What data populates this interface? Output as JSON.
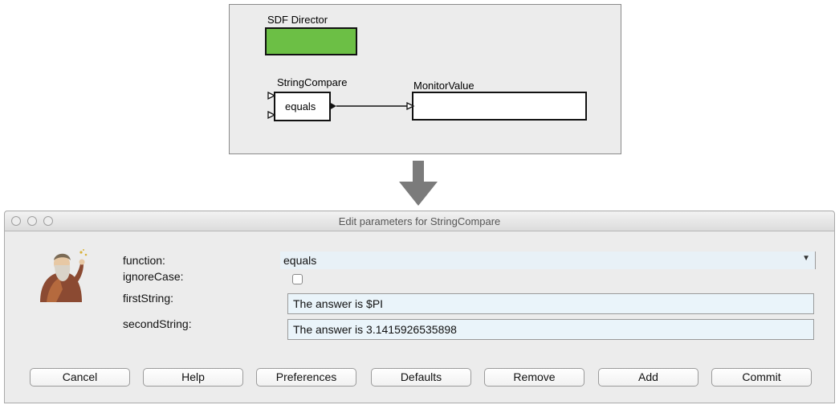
{
  "diagram": {
    "director_label": "SDF Director",
    "actor1_label": "StringCompare",
    "actor1_text": "equals",
    "actor2_label": "MonitorValue",
    "director_color": "#6cbf45"
  },
  "dialog": {
    "title": "Edit parameters for StringCompare",
    "params": {
      "function_label": "function:",
      "function_value": "equals",
      "ignorecase_label": "ignoreCase:",
      "ignorecase_checked": false,
      "firststring_label": "firstString:",
      "firststring_value": "The answer is $PI",
      "secondstring_label": "secondString:",
      "secondstring_value": "The answer is 3.1415926535898"
    },
    "buttons": {
      "cancel": "Cancel",
      "help": "Help",
      "preferences": "Preferences",
      "defaults": "Defaults",
      "remove": "Remove",
      "add": "Add",
      "commit": "Commit"
    }
  },
  "icons": {
    "window_controls": [
      "close-icon",
      "minimize-icon",
      "zoom-icon"
    ],
    "portrait": "portrait-icon",
    "dropdown": "chevron-down-icon",
    "arrow": "down-arrow-icon"
  }
}
